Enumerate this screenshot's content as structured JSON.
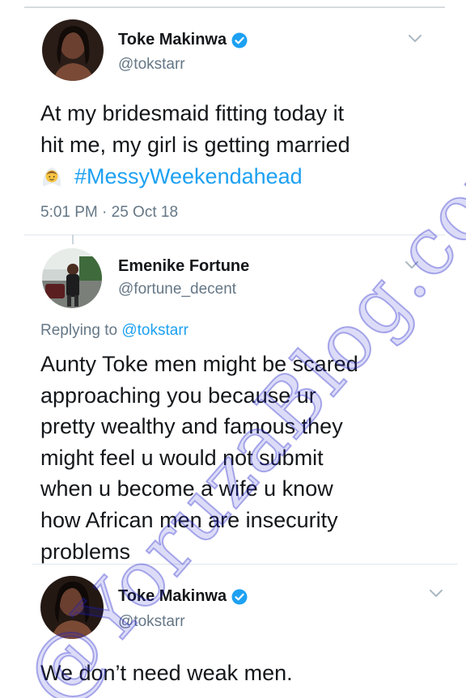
{
  "watermark": "@YoruzaBlog.com",
  "tweets": [
    {
      "name": "Toke Makinwa",
      "handle": "@tokstarr",
      "verified": true,
      "body_line1": "At my bridesmaid fitting today it",
      "body_line2": "hit me, my girl is getting married",
      "hashtag": "#MessyWeekendahead",
      "emoji": "bride-with-veil-emoji",
      "timestamp": "5:01 PM · 25 Oct 18"
    },
    {
      "name": "Emenike Fortune",
      "handle": "@fortune_decent",
      "verified": false,
      "replying_label": "Replying to",
      "replying_to": "@tokstarr",
      "body_lines": [
        "Aunty Toke men might be scared",
        "approaching you because ur",
        "pretty wealthy and famous they",
        "might feel u would not submit",
        "when u become a wife u know",
        "how African men are insecurity",
        "problems"
      ]
    },
    {
      "name": "Toke Makinwa",
      "handle": "@tokstarr",
      "verified": true,
      "body": "We don’t need weak men."
    }
  ],
  "icons": {
    "verified": "verified-badge-icon",
    "more": "chevron-down-icon"
  },
  "colors": {
    "link_blue": "#1da1f2",
    "secondary_text": "#657786",
    "primary_text": "#14171a",
    "watermark": "#2828d2"
  }
}
